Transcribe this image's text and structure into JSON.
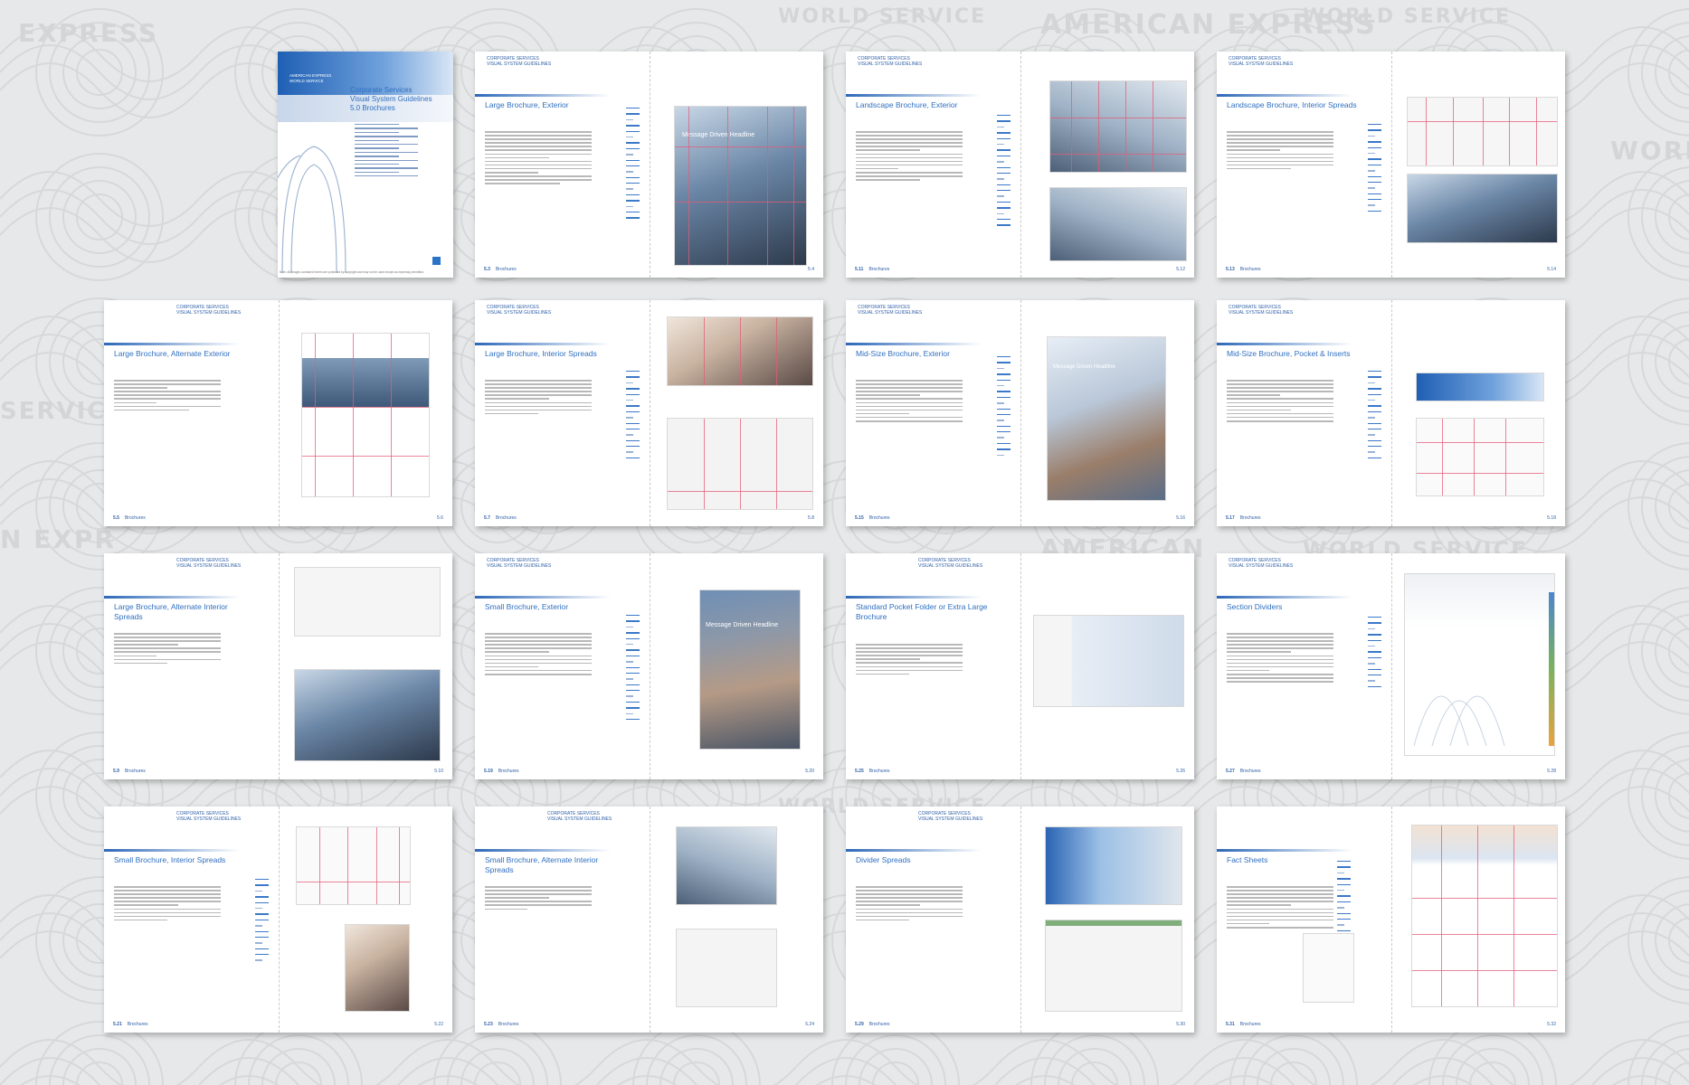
{
  "watermark": {
    "texts": [
      "WORLD SERVICE",
      "AMERICAN EXPRESS",
      "EXPRESS",
      "WORLD S",
      "SERVICE",
      "N EXPR",
      "AMERICAN"
    ]
  },
  "colors": {
    "brand_blue": "#2f6fc0",
    "grid_pink": "#e45c78",
    "background": "#e7e8e9"
  },
  "cover": {
    "brand_label": "AMERICAN EXPRESS",
    "brand_sub": "WORLD SERVICE",
    "title_line1": "Corporate Services",
    "title_line2": "Visual System Guidelines",
    "title_line3": "5.0 Brochures",
    "footer_note": "Note: All images contained herein are protected by copyright and may not be used except as expressly permitted."
  },
  "header_tag": {
    "line1": "CORPORATE SERVICES",
    "line2": "VISUAL SYSTEM GUIDELINES"
  },
  "section_label": "Brochures",
  "spreads": [
    {
      "title": "Large Brochure, Exterior",
      "folio_left": "5.3",
      "folio_right": "5.4"
    },
    {
      "title": "Landscape Brochure, Exterior",
      "folio_left": "5.11",
      "folio_right": "5.12"
    },
    {
      "title": "Landscape Brochure, Interior Spreads",
      "folio_left": "5.13",
      "folio_right": "5.14"
    },
    {
      "title": "Large Brochure, Alternate Exterior",
      "folio_left": "5.5",
      "folio_right": "5.6"
    },
    {
      "title": "Large Brochure, Interior Spreads",
      "folio_left": "5.7",
      "folio_right": "5.8"
    },
    {
      "title": "Mid-Size Brochure, Exterior",
      "folio_left": "5.15",
      "folio_right": "5.16"
    },
    {
      "title": "Mid-Size Brochure, Pocket & Inserts",
      "folio_left": "5.17",
      "folio_right": "5.18"
    },
    {
      "title": "Large Brochure, Alternate Interior Spreads",
      "folio_left": "5.9",
      "folio_right": "5.10"
    },
    {
      "title": "Small Brochure, Exterior",
      "folio_left": "5.19",
      "folio_right": "5.20"
    },
    {
      "title": "Standard Pocket Folder or Extra Large Brochure",
      "folio_left": "5.25",
      "folio_right": "5.26"
    },
    {
      "title": "Section Dividers",
      "folio_left": "5.27",
      "folio_right": "5.28"
    },
    {
      "title": "Small Brochure, Interior Spreads",
      "folio_left": "5.21",
      "folio_right": "5.22"
    },
    {
      "title": "Small Brochure, Alternate Interior Spreads",
      "folio_left": "5.23",
      "folio_right": "5.24"
    },
    {
      "title": "Divider Spreads",
      "folio_left": "5.29",
      "folio_right": "5.30"
    },
    {
      "title": "Fact Sheets",
      "folio_left": "5.31",
      "folio_right": "5.32"
    }
  ],
  "mock_headline": "Message Driven Headline"
}
